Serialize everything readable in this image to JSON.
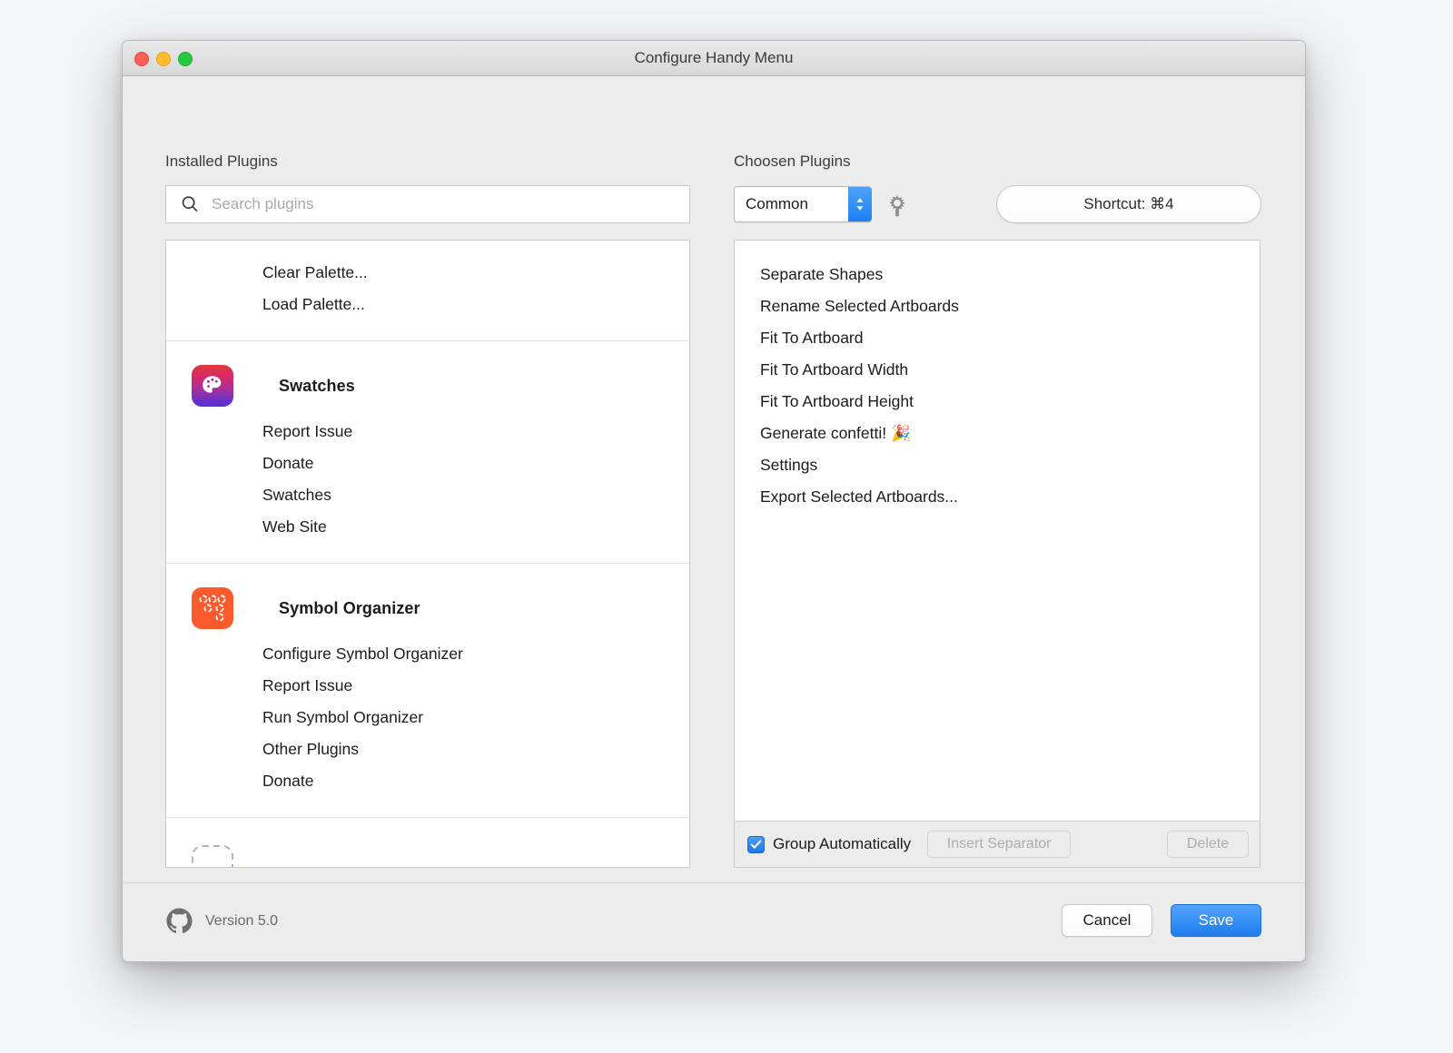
{
  "window": {
    "title": "Configure Handy Menu",
    "traffic_lights": [
      "close",
      "minimize",
      "zoom"
    ]
  },
  "left": {
    "label": "Installed Plugins",
    "search": {
      "placeholder": "Search plugins",
      "value": "",
      "icon": "search-icon"
    },
    "groups": [
      {
        "plugin": null,
        "icon": null,
        "items": [
          "Clear Palette...",
          "Load Palette..."
        ]
      },
      {
        "plugin": "Swatches",
        "icon": "swatches-plugin-icon",
        "items": [
          "Report Issue",
          "Donate",
          "Swatches",
          "Web Site"
        ]
      },
      {
        "plugin": "Symbol Organizer",
        "icon": "symbol-organizer-plugin-icon",
        "items": [
          "Configure Symbol Organizer",
          "Report Issue",
          "Run Symbol Organizer",
          "Other Plugins",
          "Donate"
        ]
      }
    ]
  },
  "right": {
    "label": "Choosen Plugins",
    "menu_select": {
      "value": "Common",
      "options": [
        "Common"
      ]
    },
    "gear_icon": "gear-icon",
    "shortcut_button": "Shortcut: ⌘4",
    "items": [
      "Separate Shapes",
      "Rename Selected Artboards",
      "Fit To Artboard",
      "Fit To Artboard Width",
      "Fit To Artboard Height",
      "Generate confetti! 🎉",
      "Settings",
      "Export Selected Artboards..."
    ],
    "group_automatically": {
      "label": "Group Automatically",
      "checked": true
    },
    "insert_separator_label": "Insert Separator",
    "delete_label": "Delete"
  },
  "footer": {
    "github_icon": "github-icon",
    "version": "Version 5.0",
    "cancel_label": "Cancel",
    "save_label": "Save"
  },
  "colors": {
    "accent_blue": "#1f7cf0",
    "swatches_icon_top": "#e23a3a",
    "swatches_icon_bottom": "#5b2fd0",
    "symbol_icon": "#fb5a2d",
    "window_bg": "#ececec"
  }
}
